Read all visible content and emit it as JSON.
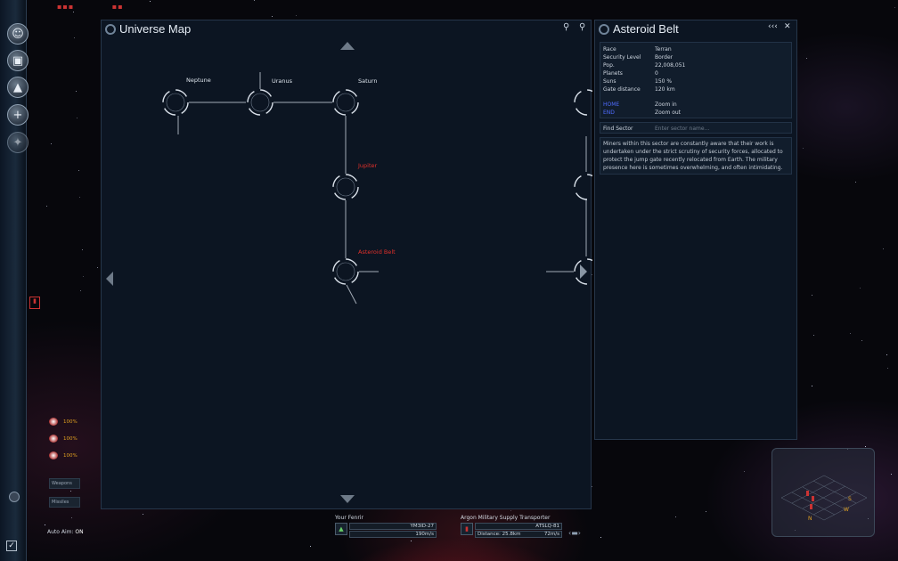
{
  "map_panel": {
    "title": "Universe Map",
    "sectors": {
      "neptune": "Neptune",
      "uranus": "Uranus",
      "saturn": "Saturn",
      "jupiter": "Jupiter",
      "asteroid_belt": "Asteroid Belt"
    },
    "label_colors": {
      "normal": "#dde4ec",
      "highlight": "#e0302a"
    }
  },
  "info_panel": {
    "title": "Asteroid Belt",
    "controls": {
      "collapse": "‹‹‹",
      "close": "✕"
    },
    "stats": [
      {
        "key": "Race",
        "value": "Terran"
      },
      {
        "key": "Security Level",
        "value": "Border"
      },
      {
        "key": "Pop.",
        "value": "22,008,051"
      },
      {
        "key": "Planets",
        "value": "0"
      },
      {
        "key": "Suns",
        "value": "150 %"
      },
      {
        "key": "Gate distance",
        "value": "120 km"
      }
    ],
    "hotkeys": [
      {
        "key": "HOME",
        "value": "Zoom in"
      },
      {
        "key": "END",
        "value": "Zoom out"
      }
    ],
    "find": {
      "label": "Find Sector",
      "placeholder": "Enter sector name..."
    },
    "description": "Miners within this sector are constantly aware that their work is undertaken under the strict scrutiny of security forces, allocated to protect the jump gate recently relocated from Earth. The military presence here is sometimes overwhelming, and often intimidating.",
    "accent_color": "#4f6cff"
  },
  "hud": {
    "player": {
      "label": "Your Fenrir",
      "target_id": "YM3ID-27",
      "speed": "190m/s"
    },
    "target": {
      "label": "Argon Military Supply Transporter",
      "code": "ATSLQ-81",
      "distance": "Distance: 25.8km",
      "speed": "72m/s"
    },
    "autoaim": {
      "label": "Auto Aim:",
      "value": "ON"
    },
    "weapons": {
      "rows": [
        "100%",
        "100%",
        "100%"
      ],
      "weapons_label": "Weapons",
      "missiles_label": "Missiles"
    },
    "radar_markers": [
      "S",
      "W",
      "N"
    ]
  }
}
